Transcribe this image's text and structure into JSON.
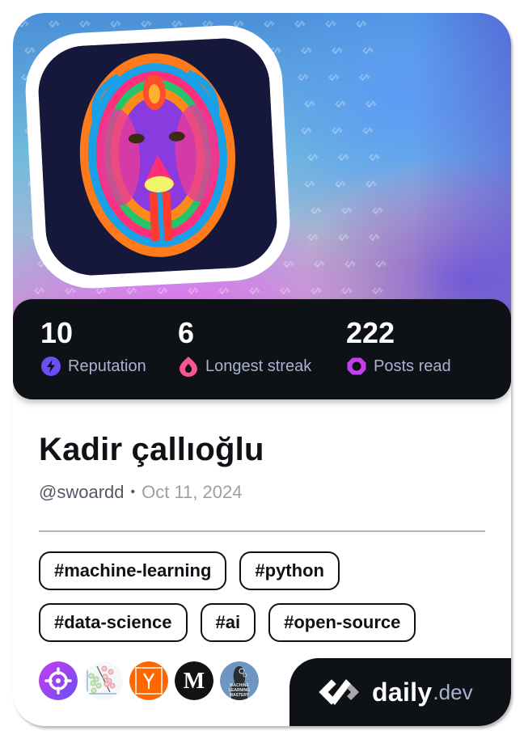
{
  "profile": {
    "name": "Kadir çallıoğlu",
    "handle": "@swoardd",
    "separator": "•",
    "joined_date": "Oct 11, 2024",
    "avatar_icon": "colorful-lion-avatar"
  },
  "stats": [
    {
      "value": "10",
      "label": "Reputation",
      "icon": "bolt-icon",
      "color": "#6c4ef5"
    },
    {
      "value": "6",
      "label": "Longest streak",
      "icon": "flame-icon",
      "color": "#f7568f"
    },
    {
      "value": "222",
      "label": "Posts read",
      "icon": "ring-icon",
      "color": "#c440ec"
    }
  ],
  "tags": [
    [
      "#machine-learning",
      "#python"
    ],
    [
      "#data-science",
      "#ai",
      "#open-source"
    ]
  ],
  "sources": [
    {
      "name": "crosshair-source-icon",
      "color": "#a44af0"
    },
    {
      "name": "ml-scatter-source-icon",
      "color": "#f5f7fa"
    },
    {
      "name": "hacker-news-source-icon",
      "color": "#ff6600",
      "glyph": "Y"
    },
    {
      "name": "medium-source-icon",
      "color": "#121212",
      "glyph": "M"
    },
    {
      "name": "machine-learning-mastery-source-icon",
      "color": "#6f95c2"
    }
  ],
  "brand": {
    "name": "daily",
    "tld": ".dev"
  },
  "colors": {
    "dark": "#0e1116",
    "label": "#a8b3cf"
  }
}
